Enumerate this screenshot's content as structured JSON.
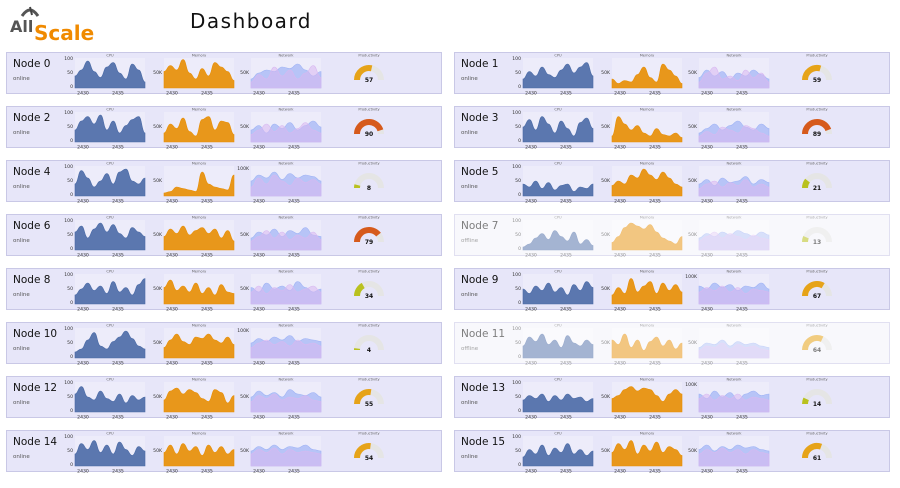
{
  "header": {
    "logo_text_1": "All",
    "logo_text_2": "Scale",
    "title": "Dashboard"
  },
  "colors": {
    "cpu": "#4a6aa6",
    "memory": "#e78f08",
    "network_a": "#9fb3f5",
    "network_b": "#d8b8f0",
    "node_bg": "#e7e6f9",
    "gauge_track": "#e5e5e5"
  },
  "labels": {
    "cpu": "CPU",
    "memory": "Memory",
    "network": "Network",
    "productivity": "Productivity"
  },
  "axis": {
    "x_ticks": [
      "2430",
      "2435"
    ],
    "cpu_ticks": [
      "100",
      "50",
      "0"
    ]
  },
  "nodes": [
    {
      "name": "Node 0",
      "status": "online",
      "productivity": 57,
      "mem_tick": "50K",
      "net_tick": "50K",
      "cpu": [
        40,
        60,
        90,
        55,
        35,
        70,
        85,
        50,
        30,
        80,
        60,
        20
      ],
      "mem": [
        55,
        75,
        60,
        95,
        50,
        30,
        65,
        40,
        85,
        70,
        55,
        25
      ],
      "net": [
        [
          30,
          50,
          60,
          55,
          70,
          65,
          80,
          60,
          40,
          55
        ],
        [
          20,
          45,
          30,
          70,
          40,
          60,
          30,
          50,
          75,
          35
        ]
      ]
    },
    {
      "name": "Node 1",
      "status": "online",
      "productivity": 59,
      "mem_tick": "50K",
      "net_tick": "50K",
      "cpu": [
        30,
        55,
        40,
        70,
        45,
        35,
        60,
        80,
        50,
        70,
        85,
        40
      ],
      "mem": [
        30,
        15,
        25,
        20,
        45,
        70,
        35,
        20,
        80,
        60,
        40,
        15
      ],
      "net": [
        [
          35,
          60,
          40,
          55,
          30,
          50,
          40,
          60,
          45,
          30
        ],
        [
          20,
          50,
          70,
          30,
          40,
          25,
          60,
          35,
          50,
          20
        ]
      ]
    },
    {
      "name": "Node 2",
      "status": "online",
      "productivity": 90,
      "mem_tick": "50K",
      "net_tick": "50K",
      "cpu": [
        40,
        70,
        85,
        60,
        90,
        40,
        70,
        30,
        55,
        75,
        85,
        30
      ],
      "mem": [
        30,
        60,
        45,
        80,
        35,
        20,
        75,
        85,
        40,
        70,
        65,
        25
      ],
      "net": [
        [
          40,
          55,
          30,
          60,
          45,
          65,
          40,
          55,
          70,
          50
        ],
        [
          25,
          40,
          60,
          35,
          55,
          30,
          45,
          65,
          40,
          30
        ]
      ]
    },
    {
      "name": "Node 3",
      "status": "online",
      "productivity": 89,
      "mem_tick": "50K",
      "net_tick": "50K",
      "cpu": [
        50,
        75,
        40,
        85,
        60,
        30,
        70,
        45,
        20,
        65,
        80,
        45
      ],
      "mem": [
        20,
        85,
        60,
        40,
        55,
        30,
        20,
        45,
        25,
        20,
        30,
        15
      ],
      "net": [
        [
          30,
          45,
          60,
          40,
          55,
          70,
          50,
          40,
          60,
          45
        ],
        [
          20,
          35,
          25,
          50,
          40,
          30,
          55,
          45,
          30,
          20
        ]
      ]
    },
    {
      "name": "Node 4",
      "status": "online",
      "productivity": 8,
      "mem_tick": "50K",
      "net_tick": "100K",
      "cpu": [
        40,
        85,
        60,
        30,
        50,
        75,
        40,
        80,
        90,
        50,
        40,
        60
      ],
      "mem": [
        10,
        15,
        30,
        25,
        20,
        15,
        80,
        40,
        30,
        25,
        20,
        70
      ],
      "net": [
        [
          50,
          70,
          60,
          80,
          55,
          75,
          60,
          70,
          65,
          50
        ],
        [
          30,
          60,
          40,
          70,
          50,
          35,
          60,
          45,
          55,
          40
        ]
      ]
    },
    {
      "name": "Node 5",
      "status": "online",
      "productivity": 21,
      "mem_tick": "50K",
      "net_tick": "50K",
      "cpu": [
        40,
        30,
        50,
        25,
        45,
        20,
        35,
        40,
        15,
        30,
        25,
        40
      ],
      "mem": [
        35,
        50,
        40,
        70,
        60,
        90,
        70,
        55,
        80,
        60,
        40,
        30
      ],
      "net": [
        [
          40,
          55,
          35,
          60,
          45,
          50,
          65,
          40,
          55,
          45
        ],
        [
          25,
          40,
          50,
          30,
          45,
          35,
          55,
          30,
          40,
          30
        ]
      ]
    },
    {
      "name": "Node 6",
      "status": "online",
      "productivity": 79,
      "mem_tick": "50K",
      "net_tick": "50K",
      "cpu": [
        60,
        80,
        40,
        70,
        90,
        60,
        85,
        55,
        40,
        75,
        60,
        45
      ],
      "mem": [
        45,
        70,
        55,
        80,
        50,
        65,
        75,
        55,
        70,
        40,
        65,
        30
      ],
      "net": [
        [
          40,
          60,
          50,
          70,
          45,
          65,
          55,
          75,
          50,
          45
        ],
        [
          30,
          45,
          65,
          40,
          60,
          35,
          50,
          40,
          60,
          35
        ]
      ]
    },
    {
      "name": "Node 7",
      "status": "offline",
      "productivity": 13,
      "mem_tick": "50K",
      "net_tick": "50K",
      "cpu": [
        10,
        20,
        40,
        55,
        35,
        65,
        45,
        30,
        60,
        20,
        35,
        15
      ],
      "mem": [
        25,
        45,
        75,
        90,
        80,
        70,
        85,
        60,
        40,
        30,
        20,
        45
      ],
      "net": [
        [
          40,
          55,
          45,
          60,
          50,
          65,
          55,
          45,
          60,
          50
        ],
        [
          30,
          45,
          60,
          40,
          55,
          45,
          35,
          50,
          40,
          35
        ]
      ]
    },
    {
      "name": "Node 8",
      "status": "online",
      "productivity": 34,
      "mem_tick": "50K",
      "net_tick": "50K",
      "cpu": [
        30,
        50,
        70,
        45,
        60,
        35,
        75,
        40,
        55,
        30,
        65,
        85
      ],
      "mem": [
        55,
        80,
        45,
        60,
        40,
        70,
        35,
        55,
        30,
        65,
        40,
        35
      ],
      "net": [
        [
          55,
          40,
          70,
          50,
          60,
          45,
          75,
          55,
          40,
          50
        ],
        [
          40,
          60,
          35,
          55,
          45,
          65,
          40,
          50,
          60,
          40
        ]
      ]
    },
    {
      "name": "Node 9",
      "status": "online",
      "productivity": 67,
      "mem_tick": "50K",
      "net_tick": "100K",
      "cpu": [
        50,
        35,
        60,
        45,
        70,
        40,
        55,
        30,
        65,
        45,
        75,
        55
      ],
      "mem": [
        30,
        55,
        35,
        85,
        40,
        60,
        75,
        35,
        70,
        45,
        65,
        40
      ],
      "net": [
        [
          60,
          50,
          70,
          55,
          65,
          45,
          60,
          55,
          70,
          50
        ],
        [
          40,
          55,
          45,
          60,
          40,
          55,
          35,
          50,
          45,
          40
        ]
      ]
    },
    {
      "name": "Node 10",
      "status": "online",
      "productivity": 4,
      "mem_tick": "50K",
      "net_tick": "100K",
      "cpu": [
        20,
        30,
        60,
        85,
        40,
        30,
        55,
        70,
        90,
        65,
        40,
        30
      ],
      "mem": [
        35,
        60,
        80,
        55,
        45,
        70,
        65,
        80,
        60,
        50,
        70,
        45
      ],
      "net": [
        [
          50,
          65,
          55,
          70,
          60,
          75,
          55,
          65,
          60,
          55
        ],
        [
          35,
          50,
          60,
          45,
          55,
          40,
          60,
          45,
          50,
          40
        ]
      ]
    },
    {
      "name": "Node 11",
      "status": "offline",
      "productivity": 64,
      "mem_tick": "50K",
      "net_tick": "50K",
      "cpu": [
        40,
        70,
        55,
        80,
        45,
        60,
        35,
        75,
        50,
        40,
        60,
        45
      ],
      "mem": [
        60,
        45,
        80,
        35,
        60,
        25,
        55,
        70,
        40,
        60,
        30,
        50
      ],
      "net": [
        [
          35,
          50,
          45,
          60,
          40,
          55,
          45,
          50,
          40,
          35
        ],
        [
          25,
          40,
          35,
          50,
          30,
          45,
          35,
          40,
          30,
          25
        ]
      ]
    },
    {
      "name": "Node 12",
      "status": "online",
      "productivity": 55,
      "mem_tick": "50K",
      "net_tick": "50K",
      "cpu": [
        60,
        85,
        50,
        40,
        70,
        45,
        35,
        60,
        30,
        55,
        40,
        50
      ],
      "mem": [
        40,
        70,
        80,
        60,
        75,
        65,
        45,
        35,
        75,
        65,
        30,
        55
      ],
      "net": [
        [
          50,
          70,
          55,
          65,
          50,
          75,
          60,
          55,
          65,
          50
        ],
        [
          35,
          55,
          45,
          60,
          40,
          50,
          45,
          55,
          40,
          35
        ]
      ]
    },
    {
      "name": "Node 13",
      "status": "online",
      "productivity": 14,
      "mem_tick": "50K",
      "net_tick": "100K",
      "cpu": [
        40,
        55,
        45,
        60,
        35,
        55,
        40,
        60,
        45,
        50,
        35,
        45
      ],
      "mem": [
        45,
        55,
        75,
        85,
        70,
        80,
        75,
        55,
        35,
        60,
        75,
        60
      ],
      "net": [
        [
          60,
          45,
          70,
          50,
          65,
          40,
          60,
          70,
          55,
          60
        ],
        [
          45,
          60,
          40,
          55,
          45,
          60,
          40,
          50,
          45,
          40
        ]
      ]
    },
    {
      "name": "Node 14",
      "status": "online",
      "productivity": 54,
      "mem_tick": "50K",
      "net_tick": "50K",
      "cpu": [
        40,
        75,
        55,
        85,
        45,
        70,
        40,
        80,
        55,
        35,
        65,
        50
      ],
      "mem": [
        45,
        70,
        40,
        75,
        50,
        65,
        35,
        70,
        45,
        65,
        40,
        55
      ],
      "net": [
        [
          50,
          65,
          55,
          70,
          55,
          65,
          60,
          70,
          55,
          50
        ],
        [
          40,
          55,
          45,
          60,
          40,
          55,
          45,
          50,
          45,
          40
        ]
      ]
    },
    {
      "name": "Node 15",
      "status": "online",
      "productivity": 61,
      "mem_tick": "50K",
      "net_tick": "50K",
      "cpu": [
        30,
        55,
        40,
        70,
        35,
        60,
        45,
        75,
        40,
        55,
        35,
        50
      ],
      "mem": [
        45,
        75,
        55,
        85,
        40,
        70,
        50,
        80,
        45,
        65,
        55,
        35
      ],
      "net": [
        [
          55,
          70,
          50,
          65,
          55,
          70,
          60,
          65,
          55,
          50
        ],
        [
          40,
          55,
          45,
          60,
          45,
          55,
          40,
          55,
          45,
          40
        ]
      ]
    }
  ]
}
